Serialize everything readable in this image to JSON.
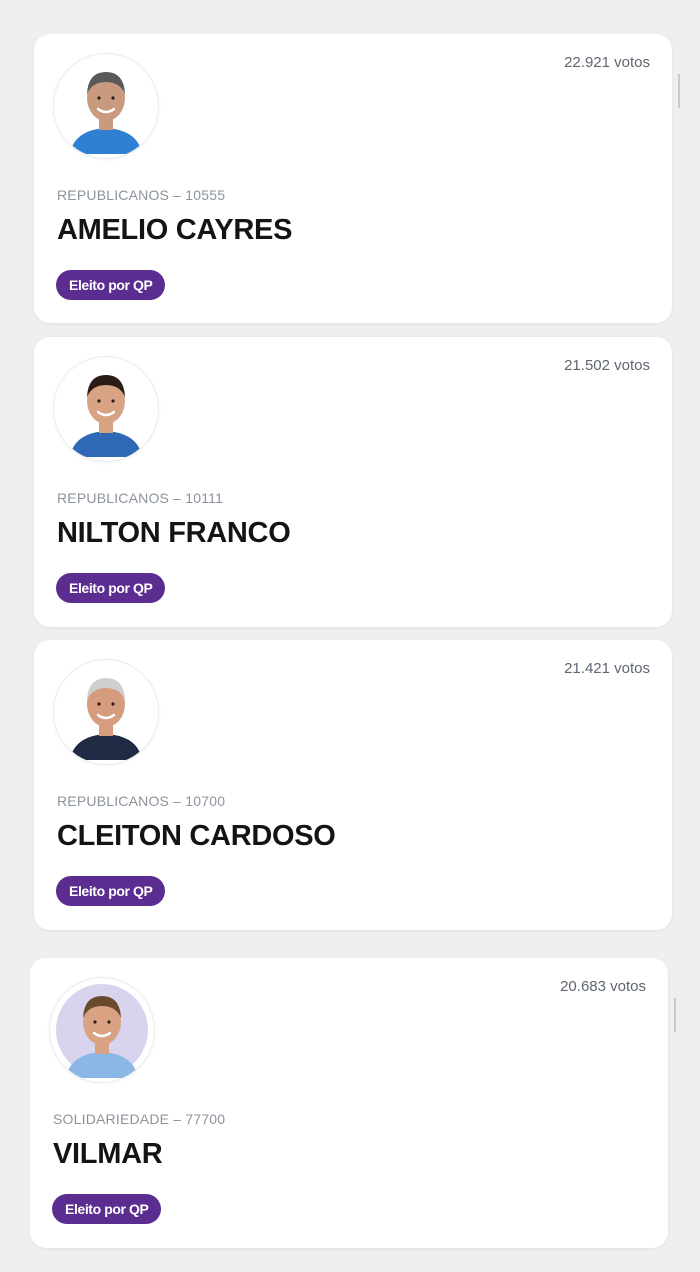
{
  "candidates": [
    {
      "votes": "22.921 votos",
      "party": "REPUBLICANOS – 10555",
      "name": "AMELIO CAYRES",
      "badge": "Eleito por QP",
      "photo": {
        "bg": "#ffffff",
        "skin": "#c99a7d",
        "hair": "#5a5a5a",
        "shirt": "#2f7fd3"
      }
    },
    {
      "votes": "21.502 votos",
      "party": "REPUBLICANOS – 10111",
      "name": "NILTON FRANCO",
      "badge": "Eleito por QP",
      "photo": {
        "bg": "#ffffff",
        "skin": "#d7a383",
        "hair": "#2b1d16",
        "shirt": "#2f68b5"
      }
    },
    {
      "votes": "21.421 votos",
      "party": "REPUBLICANOS – 10700",
      "name": "CLEITON CARDOSO",
      "badge": "Eleito por QP",
      "photo": {
        "bg": "#ffffff",
        "skin": "#d59c7e",
        "hair": "#cfcfcf",
        "shirt": "#1f2a44"
      }
    },
    {
      "votes": "20.683 votos",
      "party": "SOLIDARIEDADE – 77700",
      "name": "VILMAR",
      "badge": "Eleito por QP",
      "photo": {
        "bg": "#d9d4ee",
        "skin": "#d8a283",
        "hair": "#6a4a2c",
        "shirt": "#8bb7e6"
      }
    }
  ],
  "colors": {
    "badge": "#5b2d91",
    "page_bg": "#efeff0"
  }
}
